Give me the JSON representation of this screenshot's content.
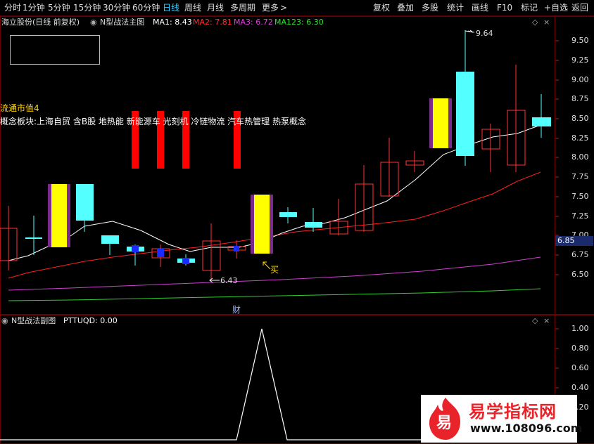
{
  "toolbar": {
    "periods": [
      "分时",
      "1分钟",
      "5分钟",
      "15分钟",
      "30分钟",
      "60分钟",
      "日线",
      "周线",
      "月线",
      "多周期",
      "更多"
    ],
    "more_arrow": ">",
    "selected": "日线",
    "actions": [
      "复权",
      "叠加",
      "多股",
      "统计",
      "画线",
      "F10",
      "标记",
      "+自选",
      "返回"
    ]
  },
  "main_panel": {
    "stock_title": "海立股份(日线 前复权)",
    "indicator_name": "N型战法主图",
    "ma1": "MA1: 8.43",
    "ma2": "MA2: 7.81",
    "ma3": "MA3: 6.72",
    "ma123": "MA123: 6.30",
    "market_cap_label": "流通市值4",
    "concept_line": "概念板块:上海自贸 含B股 地热能 新能源车 光刻机 冷链物流 汽车热管理 热泵概念",
    "high_label": "9.64",
    "low_label": "6.43",
    "buy_label": "买",
    "finance_marker": "财",
    "current_price": "6.85",
    "price_axis": [
      "9.50",
      "9.25",
      "9.00",
      "8.75",
      "8.50",
      "8.25",
      "8.00",
      "7.75",
      "7.50",
      "7.25",
      "7.00",
      "6.75",
      "6.50"
    ]
  },
  "sub_panel": {
    "indicator_name": "N型战法副图",
    "value": "PTTUQD: 0.00",
    "axis": [
      "1.00",
      "0.80",
      "0.60",
      "0.40",
      "0.20"
    ],
    "signal": [
      0,
      0,
      0,
      0,
      0,
      0,
      0,
      0,
      0,
      0,
      1,
      0,
      0,
      0,
      0,
      0,
      0,
      0,
      0,
      0,
      0,
      0
    ]
  },
  "watermark": {
    "logo_char": "易",
    "site_name": "易学指标网",
    "url": "www.108096.com"
  },
  "colors": {
    "up": "#ff3232",
    "down": "#54ffff",
    "ma1": "#ffffff",
    "ma2": "#ff2020",
    "ma3": "#d040d0",
    "ma123": "#30d030",
    "signal_bar": "#ffff00",
    "signal_edge": "#7a2a8a",
    "selected_tab": "#33ccff"
  }
}
